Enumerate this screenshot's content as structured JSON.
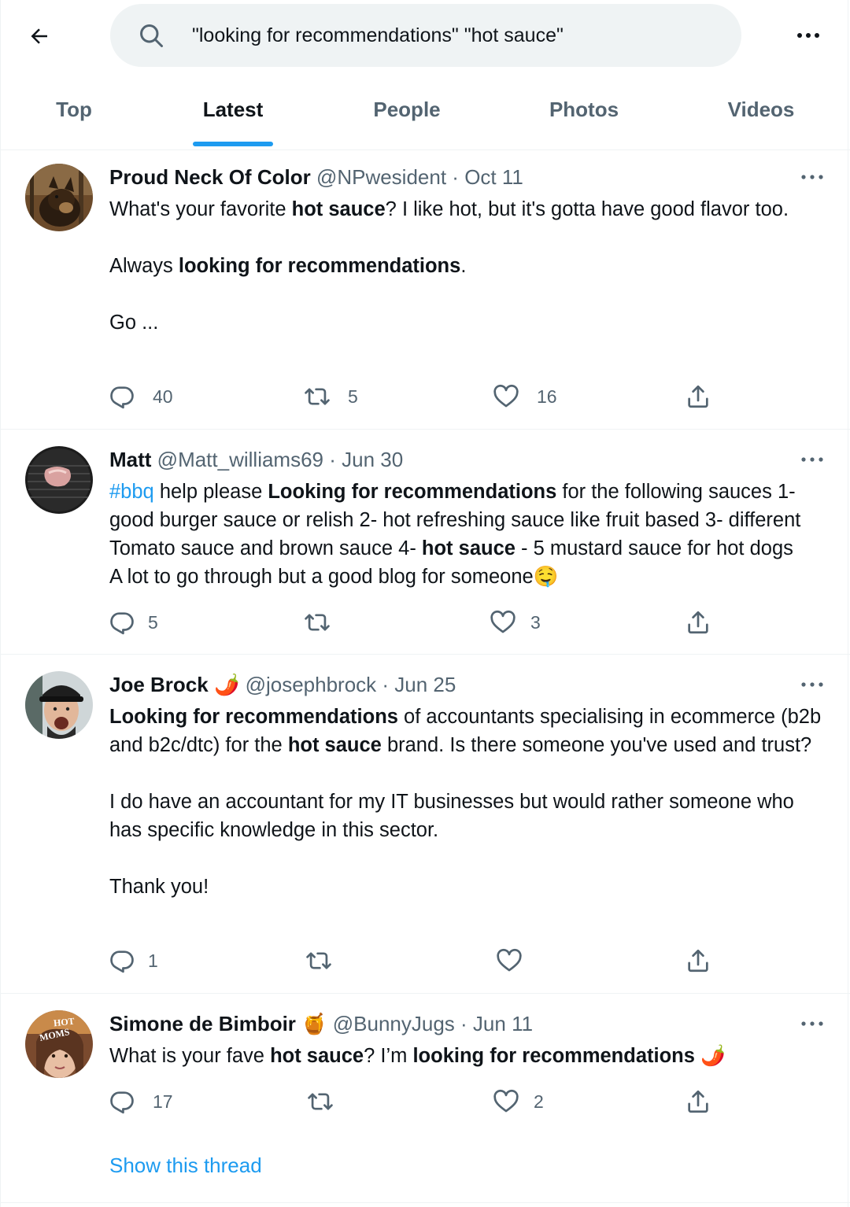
{
  "search": {
    "query": "\"looking for recommendations\" \"hot sauce\""
  },
  "tabs": [
    {
      "label": "Top"
    },
    {
      "label": "Latest"
    },
    {
      "label": "People"
    },
    {
      "label": "Photos"
    },
    {
      "label": "Videos"
    }
  ],
  "active_tab": "Latest",
  "colors": {
    "accent": "#1d9bf0",
    "text": "#0f1419",
    "muted": "#536471",
    "divider": "#eff3f4"
  },
  "icons": [
    "back-arrow-icon",
    "search-icon",
    "more-icon",
    "reply-icon",
    "retweet-icon",
    "like-icon",
    "share-icon"
  ],
  "tweets": [
    {
      "name": "Proud Neck Of Color",
      "handle": "@NPwesident",
      "date": "Oct 11",
      "text_parts": [
        "What's your favorite ",
        "hot sauce",
        "? I like hot, but it's gotta have good flavor too.",
        "Always ",
        "looking for recommendations",
        ".",
        "Go ..."
      ],
      "replies": "40",
      "retweets": "5",
      "likes": "16"
    },
    {
      "name": "Matt",
      "handle": "@Matt_williams69",
      "date": "Jun 30",
      "text_parts": [
        "#bbq",
        " help please ",
        "Looking for recommendations",
        " for the following sauces 1- good burger sauce or relish 2- hot refreshing sauce like fruit based 3- different Tomato sauce and brown sauce 4- ",
        "hot sauce",
        " - 5 mustard sauce for hot dogs    A lot to go through but a good blog for someone",
        "🤤"
      ],
      "replies": "5",
      "retweets": "",
      "likes": "3"
    },
    {
      "name": "Joe Brock",
      "name_emoji": "🌶️",
      "handle": "@josephbrock",
      "date": "Jun 25",
      "text_parts": [
        "Looking for recommendations",
        " of accountants specialising in ecommerce (b2b and b2c/dtc) for the ",
        "hot sauce",
        " brand. Is there someone you've used and trust?",
        "I do have an accountant for my IT businesses but would rather someone who has specific knowledge in this sector.",
        "Thank you!"
      ],
      "replies": "1",
      "retweets": "",
      "likes": ""
    },
    {
      "name": "Simone de Bimboir",
      "name_emoji": "🍯",
      "handle": "@BunnyJugs",
      "date": "Jun 11",
      "avatar_text": [
        "HOT",
        "MOMS"
      ],
      "text_parts": [
        "What is your fave ",
        "hot sauce",
        "? I’m ",
        "looking for recommendations",
        " 🌶️"
      ],
      "replies": "17",
      "retweets": "",
      "likes": "2",
      "thread_label": "Show this thread"
    }
  ]
}
